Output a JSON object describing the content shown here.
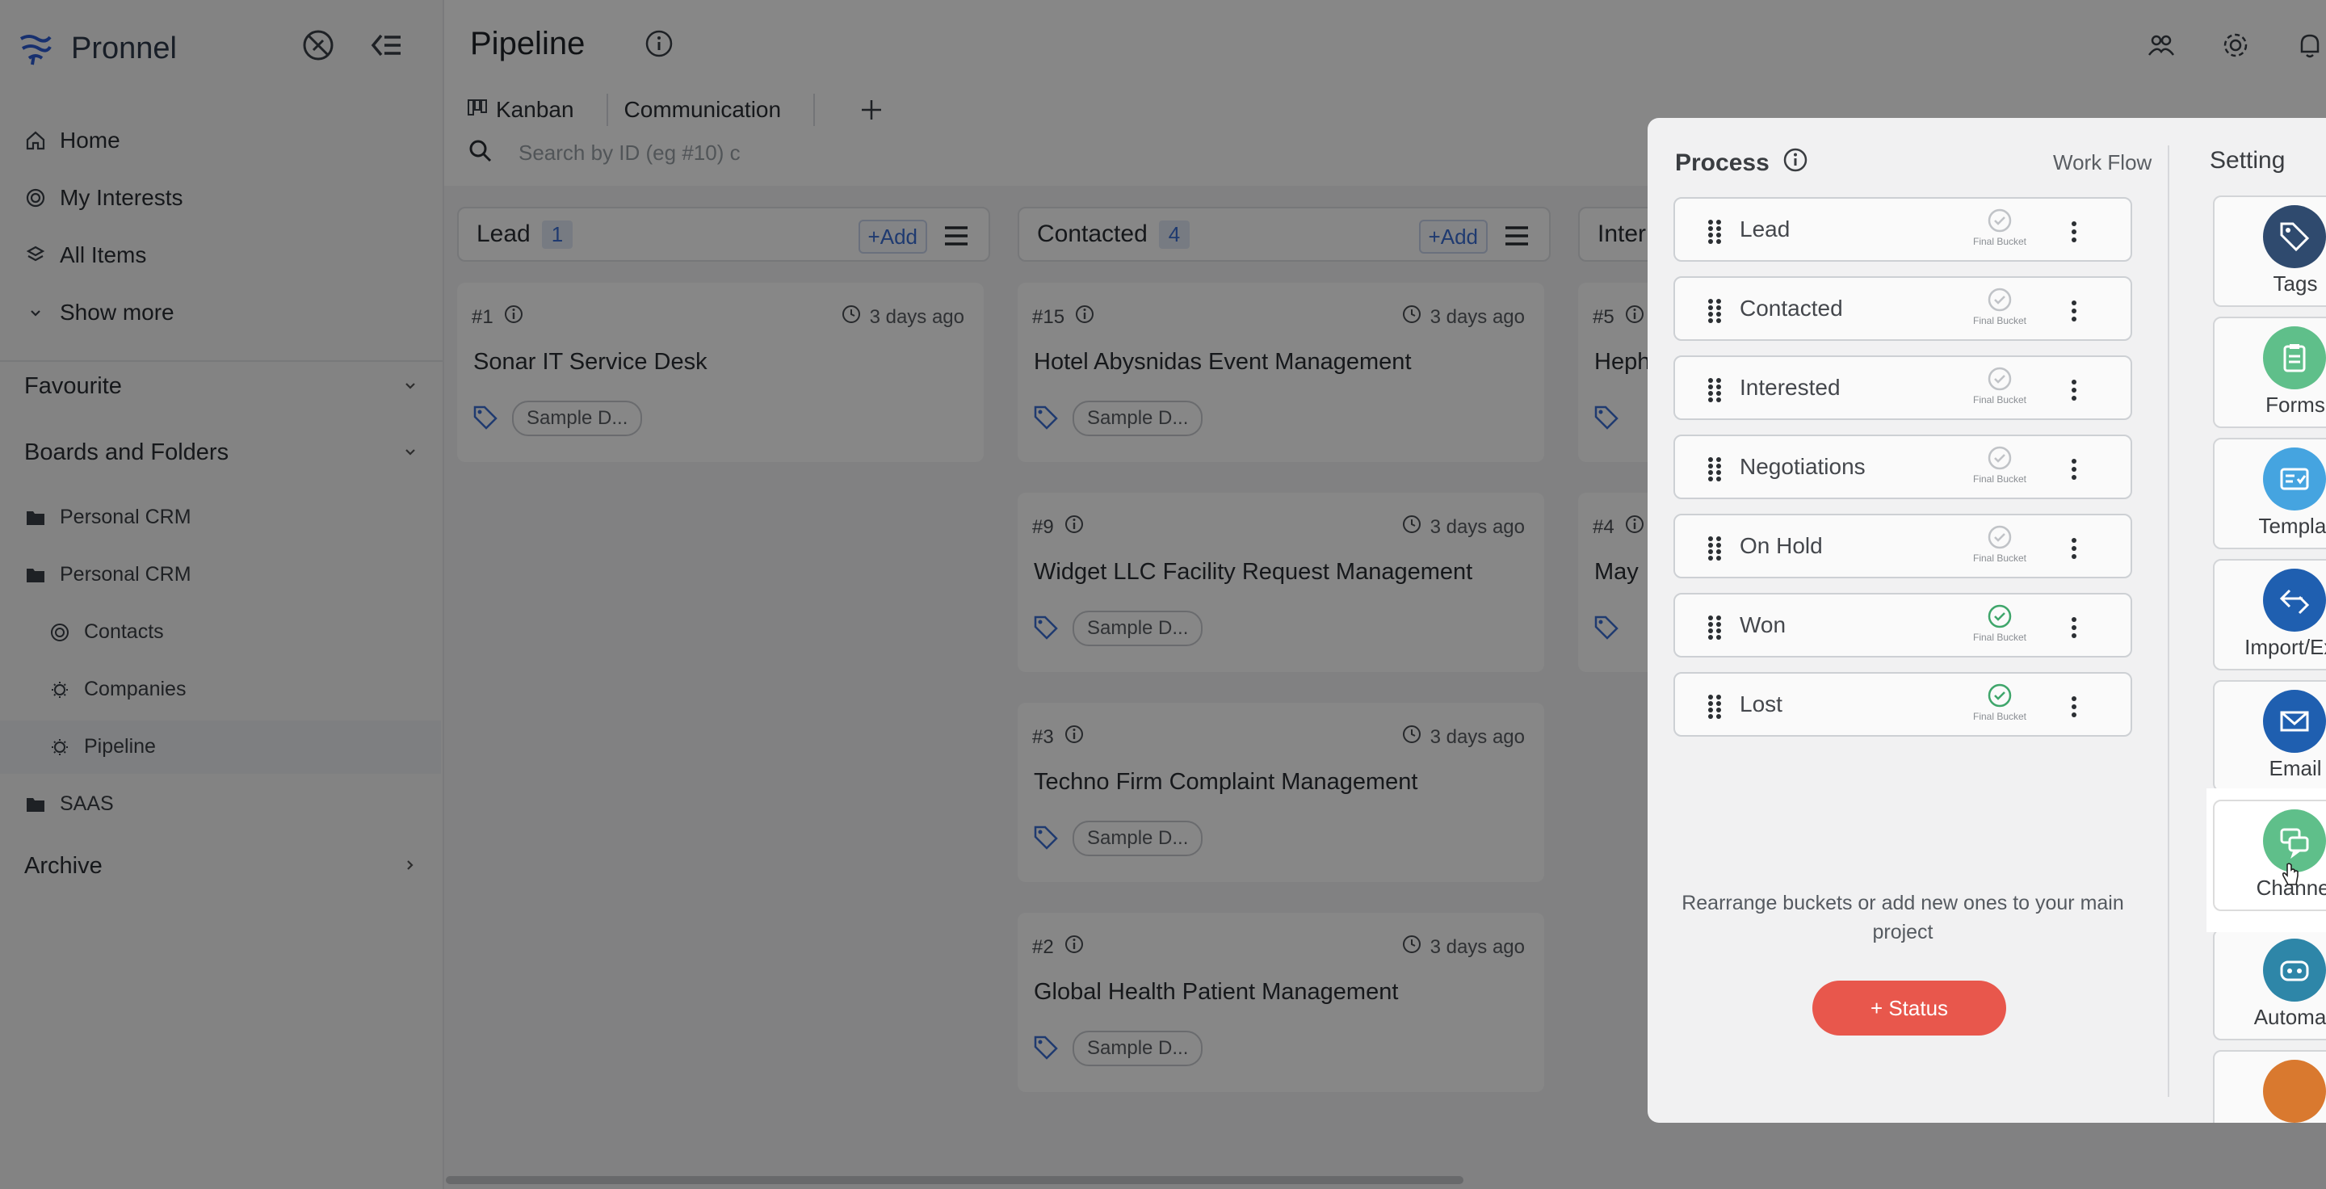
{
  "brand": {
    "name": "Pronnel"
  },
  "sidebar": {
    "nav": [
      {
        "label": "Home",
        "icon": "home-icon"
      },
      {
        "label": "My Interests",
        "icon": "target-icon"
      },
      {
        "label": "All Items",
        "icon": "items-icon"
      },
      {
        "label": "Show more",
        "icon": "chevron-down-icon"
      }
    ],
    "favourite": "Favourite",
    "boards": "Boards and Folders",
    "tree": [
      {
        "label": "Personal CRM",
        "icon": "folder-icon"
      },
      {
        "label": "Personal CRM",
        "icon": "folder-icon"
      },
      {
        "label": "Contacts",
        "icon": "target-icon"
      },
      {
        "label": "Companies",
        "icon": "bulb-icon"
      },
      {
        "label": "Pipeline",
        "icon": "bulb-icon"
      },
      {
        "label": "SAAS",
        "icon": "folder-icon"
      }
    ],
    "archive": "Archive"
  },
  "header": {
    "title": "Pipeline"
  },
  "tabs": [
    {
      "label": "Kanban"
    },
    {
      "label": "Communication"
    }
  ],
  "search": {
    "placeholder": "Search by ID (eg #10) c"
  },
  "columns": [
    {
      "name": "Lead",
      "count": "1",
      "add": "+Add"
    },
    {
      "name": "Contacted",
      "count": "4",
      "add": "+Add"
    },
    {
      "name": "Inter"
    }
  ],
  "cards": [
    {
      "id": "#1",
      "time": "3 days ago",
      "title": "Sonar IT Service Desk",
      "tag": "Sample D..."
    },
    {
      "id": "#15",
      "time": "3 days ago",
      "title": "Hotel Abysnidas Event Management",
      "tag": "Sample D..."
    },
    {
      "id": "#9",
      "time": "3 days ago",
      "title": "Widget LLC Facility Request Management",
      "tag": "Sample D..."
    },
    {
      "id": "#3",
      "time": "3 days ago",
      "title": "Techno Firm Complaint Management",
      "tag": "Sample D..."
    },
    {
      "id": "#2",
      "time": "3 days ago",
      "title": "Global Health Patient Management",
      "tag": "Sample D..."
    },
    {
      "id": "#5",
      "title": "Heph"
    },
    {
      "id": "#4",
      "title": "May"
    }
  ],
  "modal": {
    "process_title": "Process",
    "workflow": "Work Flow",
    "final_label": "Final Bucket",
    "buckets": [
      {
        "name": "Lead",
        "final": false
      },
      {
        "name": "Contacted",
        "final": false
      },
      {
        "name": "Interested",
        "final": false
      },
      {
        "name": "Negotiations",
        "final": false
      },
      {
        "name": "On Hold",
        "final": false
      },
      {
        "name": "Won",
        "final": true
      },
      {
        "name": "Lost",
        "final": true
      }
    ],
    "help_text": "Rearrange buckets or add new ones to your main project",
    "status_button": "+ Status",
    "settings_title": "Setting",
    "settings": [
      {
        "label": "Tags",
        "color": "#2f4a6e"
      },
      {
        "label": "Forms",
        "color": "#5fbf8a"
      },
      {
        "label": "Templat",
        "color": "#45a4e0"
      },
      {
        "label": "Import/Exp",
        "color": "#1f5fb0"
      },
      {
        "label": "Email",
        "color": "#1f5fb0"
      },
      {
        "label": "Channel",
        "color": "#5fbf8a"
      },
      {
        "label": "Automati",
        "color": "#2e86a8"
      }
    ]
  },
  "colors": {
    "accent": "#3b6fd3",
    "status": "#e8574c"
  }
}
